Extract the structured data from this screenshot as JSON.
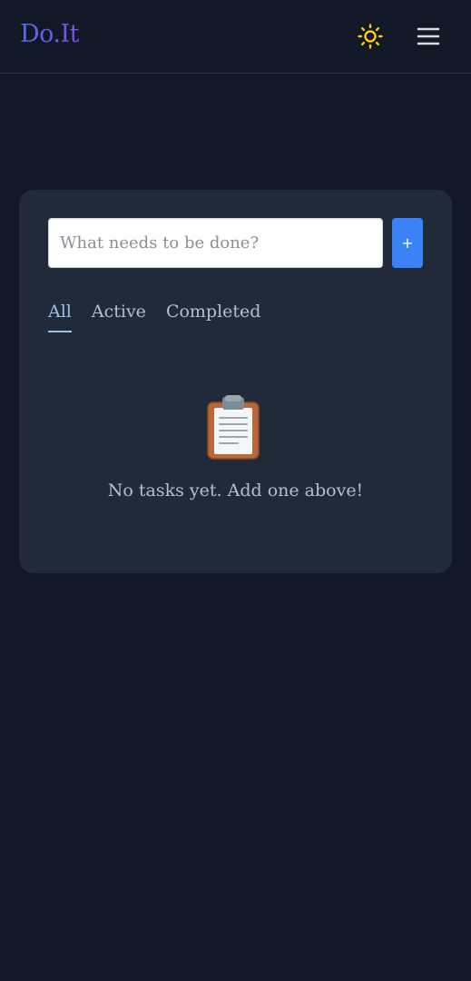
{
  "header": {
    "logo": "Do.It",
    "theme_icon": "sun-icon",
    "menu_icon": "hamburger-menu-icon"
  },
  "task_form": {
    "input_value": "",
    "placeholder": "What needs to be done?",
    "add_label": "+"
  },
  "tabs": [
    {
      "label": "All",
      "active": true
    },
    {
      "label": "Active",
      "active": false
    },
    {
      "label": "Completed",
      "active": false
    }
  ],
  "empty_state": {
    "icon": "clipboard-icon",
    "message": "No tasks yet. Add one above!"
  },
  "colors": {
    "background": "#121826",
    "card": "#212a39",
    "accent": "#3b82f6",
    "active_tab": "#9cc2f5",
    "sun": "#facc15"
  }
}
